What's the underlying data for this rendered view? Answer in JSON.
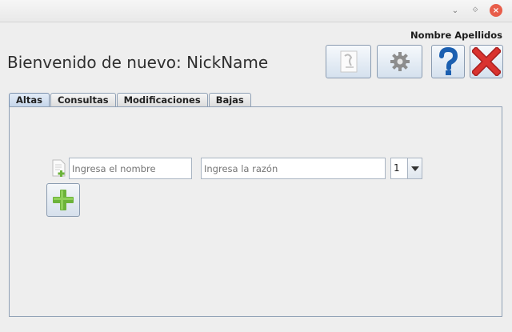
{
  "window": {
    "minimize_glyph": "⌄",
    "maximize_glyph": "⟐",
    "close_glyph": "×"
  },
  "header": {
    "user_name": "Nombre Apellidos",
    "welcome": "Bienvenido de nuevo: NickName"
  },
  "toolbar": {
    "buttons": [
      {
        "icon": "document-icon",
        "name": "document-button"
      },
      {
        "icon": "gear-icon",
        "name": "settings-button"
      },
      {
        "icon": "help-icon",
        "name": "help-button"
      },
      {
        "icon": "close-x-icon",
        "name": "exit-button"
      }
    ],
    "colors": {
      "help": "#1b5fb0",
      "exit": "#d22b2b",
      "add": "#6cb33a"
    }
  },
  "tabs": [
    {
      "label": "Altas",
      "active": true
    },
    {
      "label": "Consultas",
      "active": false
    },
    {
      "label": "Modificaciones",
      "active": false
    },
    {
      "label": "Bajas",
      "active": false
    }
  ],
  "form": {
    "nombre_placeholder": "Ingresa el nombre",
    "razon_placeholder": "Ingresa la razón",
    "quantity_value": "1"
  }
}
